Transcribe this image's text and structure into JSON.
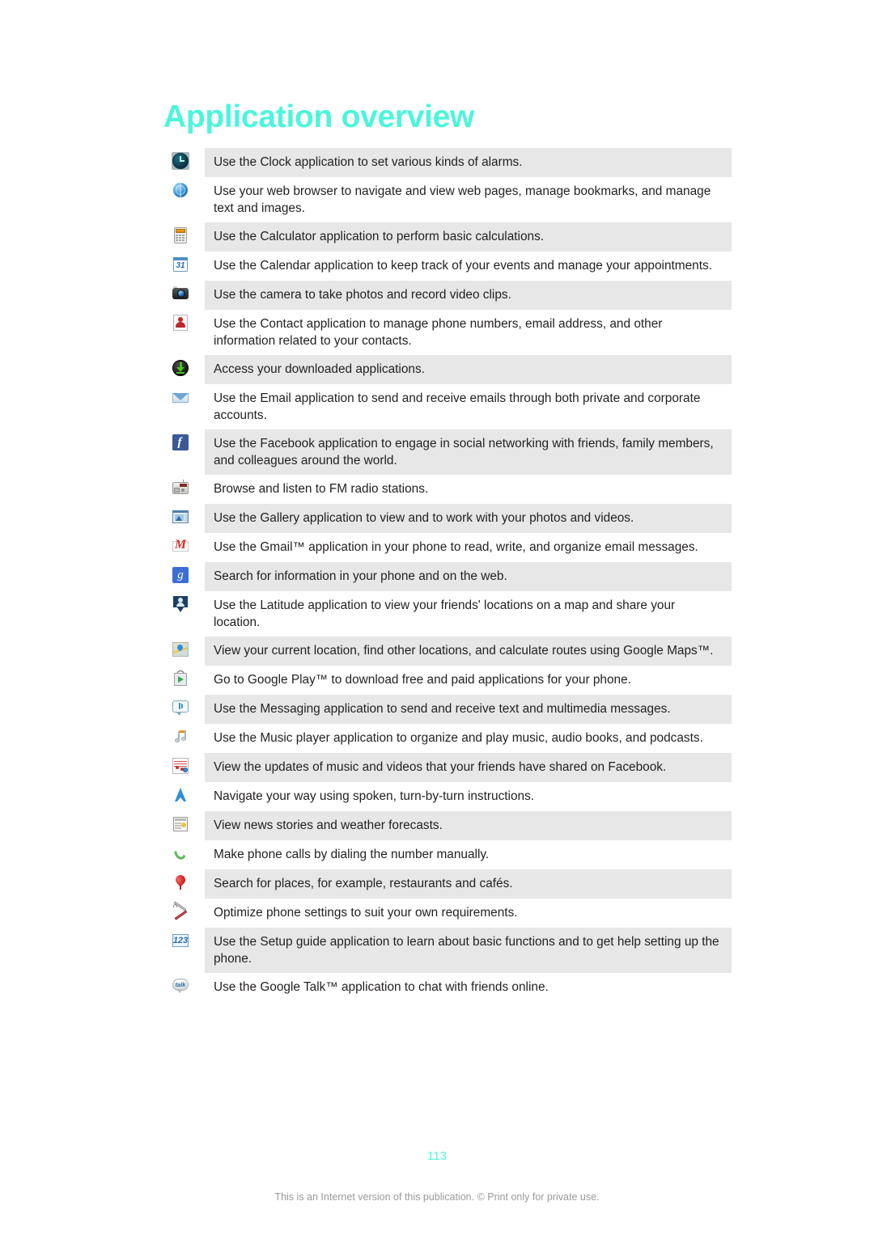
{
  "title": "Application overview",
  "page_number": "113",
  "footer_note": "This is an Internet version of this publication. © Print only for private use.",
  "colors": {
    "accent": "#4DF5DC",
    "row_shade": "#E7E7E7",
    "body_text": "#231F20",
    "footer_text": "#9A9A9A"
  },
  "rows": [
    {
      "icon": "clock-icon",
      "text": "Use the Clock application to set various kinds of alarms.",
      "shaded": true
    },
    {
      "icon": "browser-icon",
      "text": "Use your web browser to navigate and view web pages, manage bookmarks, and manage text and images.",
      "shaded": false
    },
    {
      "icon": "calculator-icon",
      "text": "Use the Calculator application to perform basic calculations.",
      "shaded": true
    },
    {
      "icon": "calendar-icon",
      "text": "Use the Calendar application to keep track of your events and manage your appointments.",
      "shaded": false
    },
    {
      "icon": "camera-icon",
      "text": "Use the camera to take photos and record video clips.",
      "shaded": true
    },
    {
      "icon": "contacts-icon",
      "text": "Use the Contact application to manage phone numbers, email address, and other information related to your contacts.",
      "shaded": false
    },
    {
      "icon": "downloads-icon",
      "text": "Access your downloaded applications.",
      "shaded": true
    },
    {
      "icon": "email-icon",
      "text": "Use the Email application to send and receive emails through both private and corporate accounts.",
      "shaded": false
    },
    {
      "icon": "facebook-icon",
      "text": "Use the Facebook application to engage in social networking with friends, family members, and colleagues around the world.",
      "shaded": true
    },
    {
      "icon": "fm-radio-icon",
      "text": "Browse and listen to FM radio stations.",
      "shaded": false
    },
    {
      "icon": "gallery-icon",
      "text": "Use the Gallery application to view and to work with your photos and videos.",
      "shaded": true
    },
    {
      "icon": "gmail-icon",
      "text": "Use the Gmail™ application in your phone to read, write, and organize email messages.",
      "shaded": false
    },
    {
      "icon": "google-search-icon",
      "text": "Search for information in your phone and on the web.",
      "shaded": true
    },
    {
      "icon": "latitude-icon",
      "text": "Use the Latitude application to view your friends' locations on a map and share your location.",
      "shaded": false
    },
    {
      "icon": "maps-icon",
      "text": "View your current location, find other locations, and calculate routes using Google Maps™.",
      "shaded": true
    },
    {
      "icon": "play-store-icon",
      "text": "Go to Google Play™ to download free and paid applications for your phone.",
      "shaded": false
    },
    {
      "icon": "messaging-icon",
      "text": "Use the Messaging application to send and receive text and multimedia messages.",
      "shaded": true
    },
    {
      "icon": "music-icon",
      "text": "Use the Music player application to organize and play music, audio books, and podcasts.",
      "shaded": false
    },
    {
      "icon": "music-unlimited-icon",
      "text": "View the updates of music and videos that your friends have shared on Facebook.",
      "shaded": true
    },
    {
      "icon": "navigation-icon",
      "text": "Navigate your way using spoken, turn-by-turn instructions.",
      "shaded": false
    },
    {
      "icon": "news-weather-icon",
      "text": "View news stories and weather forecasts.",
      "shaded": true
    },
    {
      "icon": "phone-icon",
      "text": "Make phone calls by dialing the number manually.",
      "shaded": false
    },
    {
      "icon": "places-icon",
      "text": "Search for places, for example, restaurants and cafés.",
      "shaded": true
    },
    {
      "icon": "settings-icon",
      "text": "Optimize phone settings to suit your own requirements.",
      "shaded": false
    },
    {
      "icon": "setup-guide-icon",
      "text": "Use the Setup guide application to learn about basic functions and to get help setting up the phone.",
      "shaded": true
    },
    {
      "icon": "google-talk-icon",
      "text": "Use the Google Talk™ application to chat with friends online.",
      "shaded": false
    }
  ],
  "icon_glyph_text": {
    "calendar-icon": "31",
    "facebook-icon": "f",
    "gmail-icon": "M",
    "google-search-icon": "g",
    "setup-guide-icon": "123",
    "google-talk-icon": "talk"
  }
}
